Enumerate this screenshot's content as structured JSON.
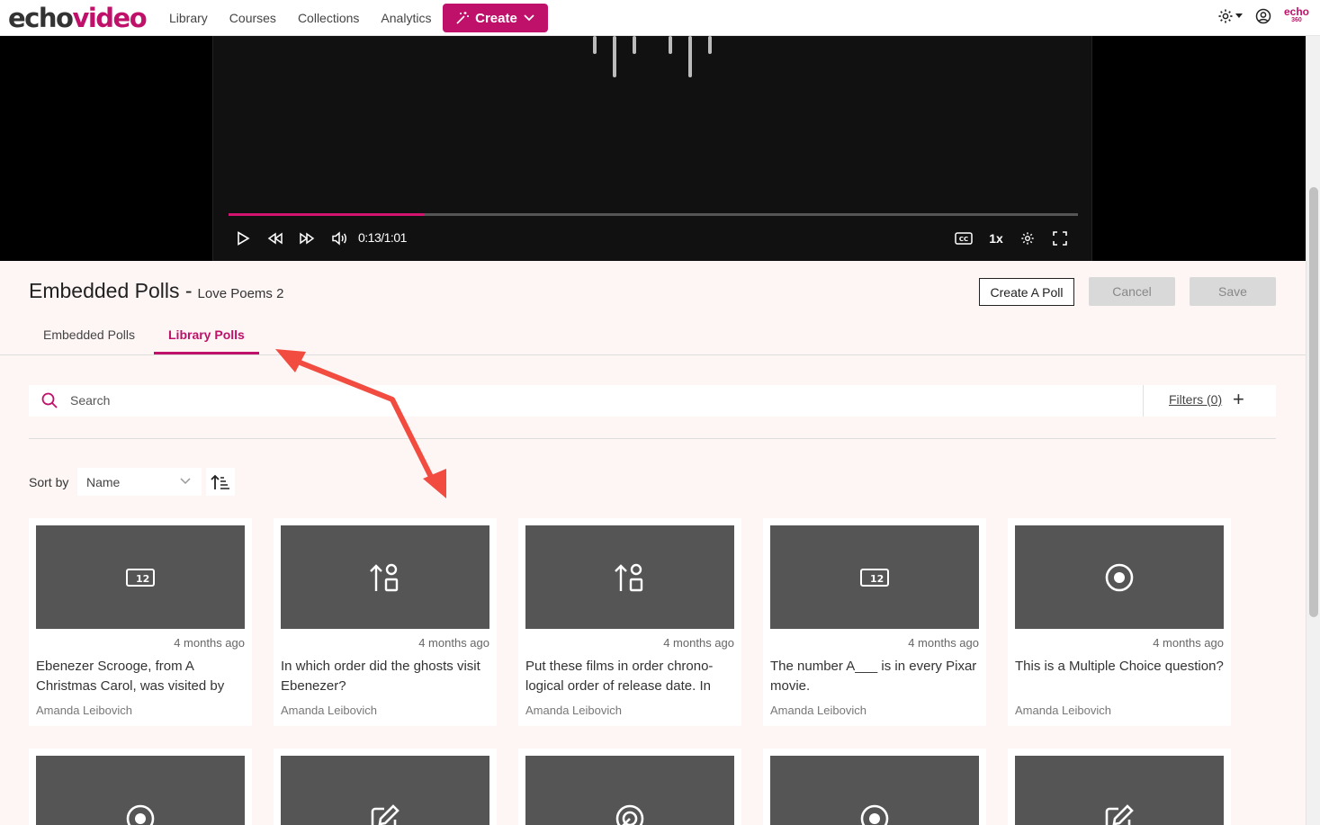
{
  "header": {
    "logo_part1": "echo",
    "logo_part2": "video",
    "nav": [
      "Library",
      "Courses",
      "Collections",
      "Analytics"
    ],
    "create_label": "Create",
    "brand_top": "echo",
    "brand_bottom": "360",
    "icons": [
      "gear-icon",
      "user-circle-icon"
    ]
  },
  "player": {
    "time": "0:13/1:01",
    "speed": "1x",
    "progress_fraction": 0.23,
    "accent": "#d2146f"
  },
  "page": {
    "title": "Embedded Polls -",
    "subtitle": "Love Poems 2",
    "create_poll": "Create A Poll",
    "cancel": "Cancel",
    "save": "Save"
  },
  "tabs": [
    "Embedded Polls",
    "Library Polls"
  ],
  "active_tab": "Library Polls",
  "search": {
    "placeholder": "Search",
    "filters": "Filters (0)"
  },
  "sort": {
    "label": "Sort by",
    "value": "Name"
  },
  "cards": [
    {
      "icon": "numeric-icon",
      "ago": "4 months ago",
      "title": "Ebenezer Scrooge, from A Christmas Carol, was visited by",
      "author": "Amanda Leibovich"
    },
    {
      "icon": "ordering-icon",
      "ago": "4 months ago",
      "title": "In which order did the ghosts visit Ebenezer?",
      "author": "Amanda Leibovich"
    },
    {
      "icon": "ordering-icon",
      "ago": "4 months ago",
      "title": "Put these films in order chrono-logical order of release date. In",
      "author": "Amanda Leibovich"
    },
    {
      "icon": "numeric-icon",
      "ago": "4 months ago",
      "title": "The number A___ is in every Pixar movie.",
      "author": "Amanda Leibovich"
    },
    {
      "icon": "multiple-choice-icon",
      "ago": "4 months ago",
      "title": "This is a Multiple Choice question?",
      "author": "Amanda Leibovich"
    }
  ],
  "cards_row2_icons": [
    "multiple-choice-icon",
    "edit-icon",
    "hotspot-icon",
    "multiple-choice-icon",
    "edit-icon"
  ],
  "colors": {
    "brand": "#c0116a",
    "annotation_arrow": "#f24c40"
  }
}
